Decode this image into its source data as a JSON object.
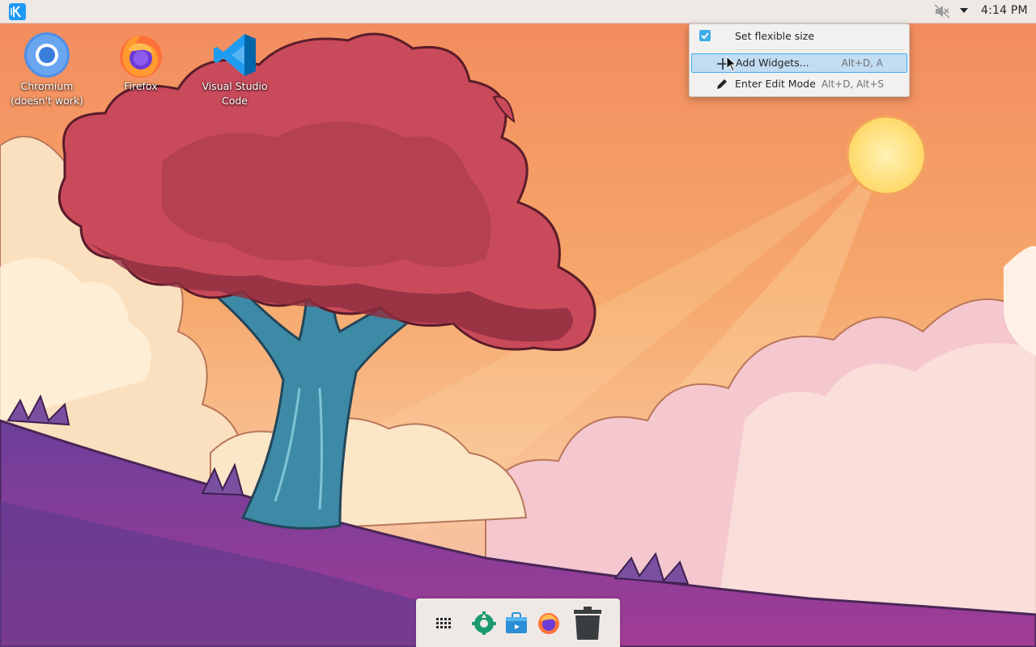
{
  "top_panel": {
    "launcher_icon": "kde-logo-icon",
    "tray_icons": [
      "audio-muted-icon",
      "tray-expand-arrow-icon"
    ],
    "clock": "4:14 PM"
  },
  "desktop_icons": [
    {
      "label": "Chromium (doesn't work)",
      "icon": "chromium-icon"
    },
    {
      "label": "Firefox",
      "icon": "firefox-icon"
    },
    {
      "label": "Visual Studio Code",
      "icon": "vscode-icon"
    }
  ],
  "context_menu": {
    "items": [
      {
        "label": "Set flexible size",
        "shortcut": "",
        "icon": "checkbox-checked-icon",
        "checked": true
      },
      {
        "label": "Add Widgets...",
        "shortcut": "Alt+D, A",
        "icon": "plus-icon",
        "highlighted": true
      },
      {
        "label": "Enter Edit Mode",
        "shortcut": "Alt+D, Alt+S",
        "icon": "pencil-icon"
      }
    ]
  },
  "dock": {
    "items": [
      "app-grid-icon",
      "system-settings-icon",
      "discover-store-icon",
      "firefox-icon",
      "trash-icon"
    ]
  },
  "colors": {
    "panel_bg": "#efe9e6",
    "accent": "#3daee9",
    "menu_highlight": "#c2dcf2"
  }
}
